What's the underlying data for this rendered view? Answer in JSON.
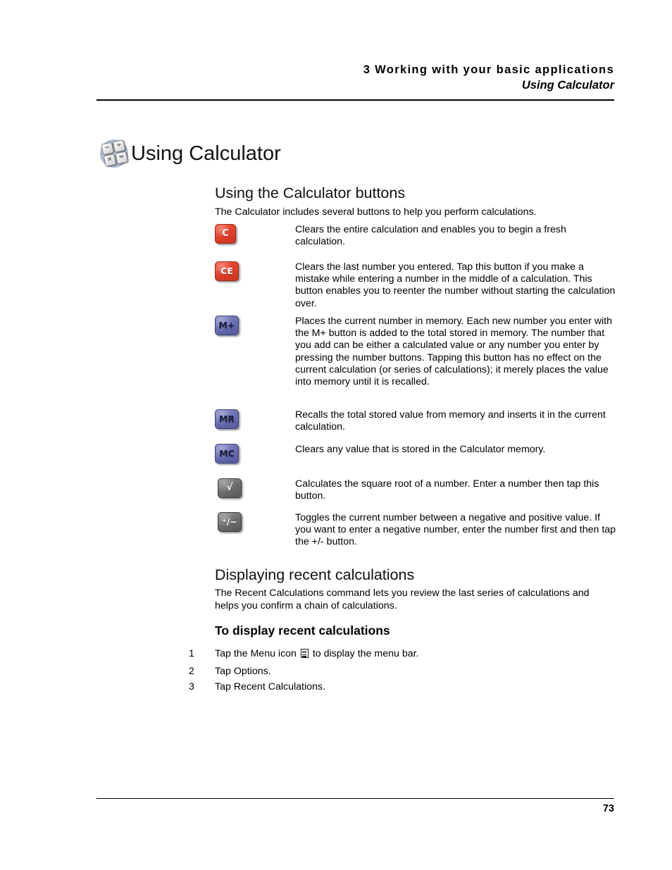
{
  "header": {
    "chapter_line": "3 Working with your basic applications",
    "section_line": "Using Calculator"
  },
  "title": {
    "text": "Using Calculator",
    "icon": "calculator-icon",
    "icon_keys": [
      "−",
      "÷",
      "×",
      "="
    ]
  },
  "sections": {
    "buttons_heading": "Using the Calculator buttons",
    "buttons_intro": "The Calculator includes several buttons to help you perform calculations.",
    "recent_heading": "Displaying recent calculations",
    "recent_intro": "The Recent Calculations command lets you review the last series of calculations and helps you confirm a chain of calculations.",
    "procedure_heading": "To display recent calculations"
  },
  "button_rows": [
    {
      "key_label": "C",
      "key_name": "clear-button",
      "key_style": "red",
      "description": "Clears the entire calculation and enables you to begin a fresh calculation."
    },
    {
      "key_label": "CE",
      "key_name": "clear-entry-button",
      "key_style": "red",
      "description": "Clears the last number you entered. Tap this button if you make a mistake while entering a number in the middle of a calculation. This button enables you to reenter the number without starting the calculation over."
    },
    {
      "key_label": "M+",
      "key_name": "memory-add-button",
      "key_style": "blue",
      "description": "Places the current number in memory. Each new number you enter with the M+ button is added to the total stored in memory. The number that you add can be either a calculated value or any number you enter by pressing the number buttons. Tapping this button has no effect on the current calculation (or series of calculations); it merely places the value into memory until it is recalled."
    },
    {
      "key_label": "MR",
      "key_name": "memory-recall-button",
      "key_style": "blue",
      "description": "Recalls the total stored value from memory and inserts it in the current calculation."
    },
    {
      "key_label": "MC",
      "key_name": "memory-clear-button",
      "key_style": "blue",
      "description": "Clears any value that is stored in the Calculator memory."
    },
    {
      "key_label": "√",
      "key_name": "square-root-button",
      "key_style": "gray",
      "description": "Calculates the square root of a number. Enter a number then tap this button."
    },
    {
      "key_label": "⁺/−",
      "key_name": "sign-toggle-button",
      "key_style": "gray",
      "description": "Toggles the current number between a negative and positive value. If you want to enter a negative number, enter the number first and then tap the +/- button."
    }
  ],
  "steps": [
    {
      "number": "1",
      "text_before": "Tap the Menu icon",
      "icon": "menu-icon",
      "text_after": "to display the menu bar."
    },
    {
      "number": "2",
      "text_before": "Tap Options.",
      "icon": null,
      "text_after": ""
    },
    {
      "number": "3",
      "text_before": "Tap Recent Calculations.",
      "icon": null,
      "text_after": ""
    }
  ],
  "footer": {
    "page_number": "73"
  },
  "colors": {
    "red_key": "#e2402a",
    "blue_key": "#6a70b2",
    "gray_key": "#6f6f6f",
    "text": "#000000"
  }
}
